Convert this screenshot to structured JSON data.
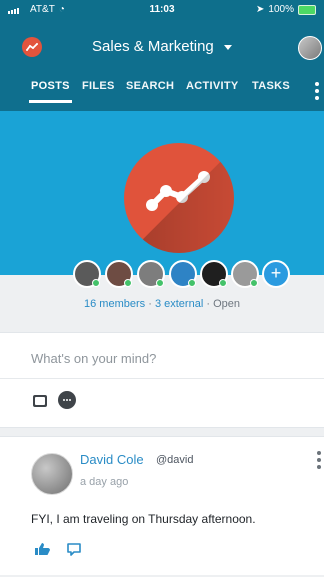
{
  "status_bar": {
    "carrier": "AT&T",
    "time": "11:03",
    "battery": "100%"
  },
  "header": {
    "workspace_name": "Sales & Marketing",
    "tabs": [
      {
        "label": "POSTS"
      },
      {
        "label": "FILES"
      },
      {
        "label": "SEARCH"
      },
      {
        "label": "ACTIVITY"
      },
      {
        "label": "TASKS"
      }
    ]
  },
  "group": {
    "members_count_label": "16 members",
    "external_label": "3 external",
    "privacy_label": "Open",
    "separator": "·"
  },
  "composer": {
    "placeholder": "What's on your mind?"
  },
  "post": {
    "author_name": "David Cole",
    "author_handle": "@david",
    "timestamp": "a day ago",
    "text": "FYI, I am traveling on Thursday afternoon."
  },
  "colors": {
    "header": "#0f6f8e",
    "banner": "#1aa3d6",
    "accent": "#2a8cc6",
    "logo": "#e0533b"
  },
  "icons": {
    "app_logo": "analytics-icon",
    "overflow": "more-vertical-icon",
    "add_member": "plus-icon",
    "composer_image": "image-icon",
    "composer_more": "more-horizontal-icon",
    "like": "thumbs-up-icon",
    "comment": "comment-icon"
  }
}
